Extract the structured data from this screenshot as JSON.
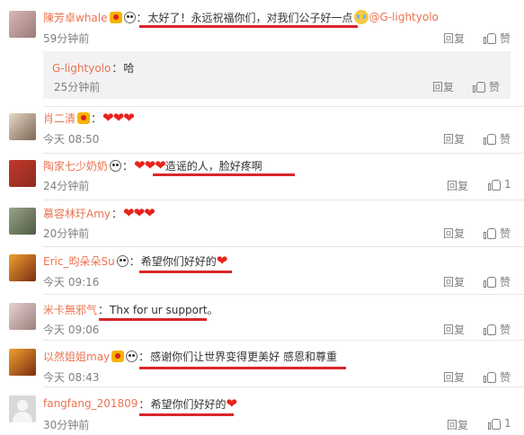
{
  "actions": {
    "reply": "回复",
    "like": "赞"
  },
  "accent_colors": {
    "username": "#eb7350",
    "underline": "#d9262b",
    "heart": "#e8231d"
  },
  "comments": [
    {
      "username": "陳芳卓whale",
      "text": "太好了！永远祝福你们，对我们公子好一点",
      "mention": "@G-lightyolo",
      "time": "59分钟前",
      "like_text": "赞",
      "reply": {
        "username": "G-lightyolo",
        "text": "哈",
        "time": "25分钟前",
        "like_text": "赞"
      }
    },
    {
      "username": "肖二清",
      "text": "",
      "time": "今天 08:50",
      "like_text": "赞"
    },
    {
      "username": "陶家七少奶奶",
      "text": "造谣的人，脸好疼啊",
      "time": "24分钟前",
      "like_text": "1"
    },
    {
      "username": "慕容林玗Amy",
      "text": "",
      "time": "20分钟前",
      "like_text": "赞"
    },
    {
      "username": "Eric_昀朵朵Su",
      "text": "希望你们好好的",
      "time": "今天 09:16",
      "like_text": "赞"
    },
    {
      "username": "米卡無邪气",
      "text": "Thx for ur support。",
      "time": "今天 09:06",
      "like_text": "赞"
    },
    {
      "username": "以然姐姐may",
      "text": "感谢你们让世界变得更美好 感恩和尊重",
      "time": "今天 08:43",
      "like_text": "赞"
    },
    {
      "username": "fangfang_201809",
      "text": "希望你们好好的",
      "time": "30分钟前",
      "like_text": "1"
    }
  ]
}
